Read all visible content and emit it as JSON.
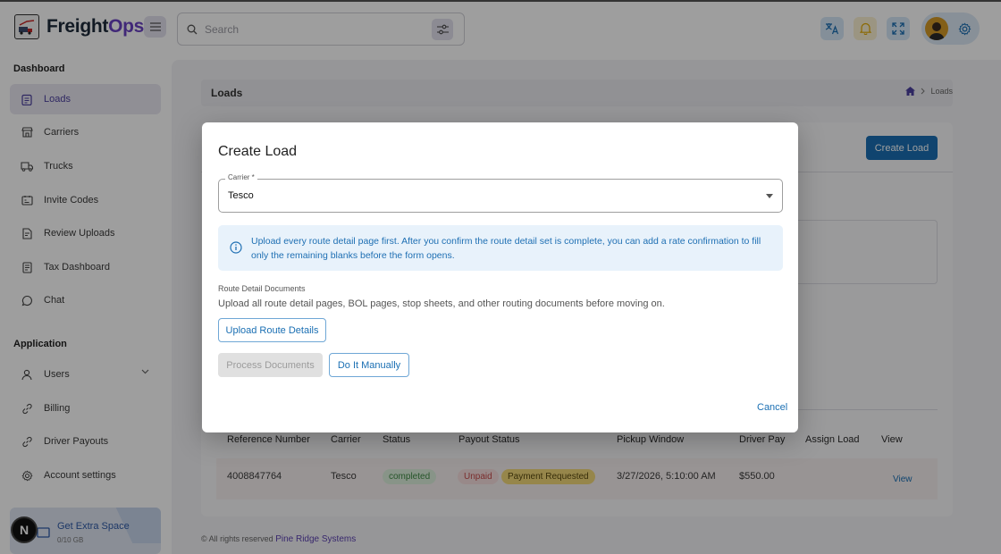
{
  "app": {
    "name_part1": "Freight",
    "name_part2": "Ops"
  },
  "header": {
    "search_placeholder": "Search",
    "colors": {
      "accent_blue": "#1a6fb3",
      "brand_purple": "#6a42c2"
    }
  },
  "sidebar": {
    "sections": [
      {
        "title": "Dashboard"
      },
      {
        "title": "Application"
      }
    ],
    "dashboard_items": [
      {
        "label": "Loads",
        "icon": "clipboard-icon",
        "active": true
      },
      {
        "label": "Carriers",
        "icon": "store-icon"
      },
      {
        "label": "Trucks",
        "icon": "truck-icon"
      },
      {
        "label": "Invite Codes",
        "icon": "ticket-icon"
      },
      {
        "label": "Review Uploads",
        "icon": "document-check-icon"
      },
      {
        "label": "Tax Dashboard",
        "icon": "receipt-icon"
      },
      {
        "label": "Chat",
        "icon": "chat-icon"
      }
    ],
    "application_items": [
      {
        "label": "Users",
        "icon": "user-icon"
      },
      {
        "label": "Billing",
        "icon": "link-icon"
      },
      {
        "label": "Driver Payouts",
        "icon": "link-icon"
      },
      {
        "label": "Account settings",
        "icon": "gear-icon"
      }
    ],
    "promo": {
      "title": "Get Extra Space",
      "subtitle": "0/10 GB"
    },
    "fab_letter": "N"
  },
  "page": {
    "title": "Loads",
    "breadcrumb": "Loads",
    "create_button": "Create Load",
    "table": {
      "headers": [
        "Reference Number",
        "Carrier",
        "Status",
        "Payout Status",
        "Pickup Window",
        "Driver Pay",
        "Assign Load",
        "View"
      ],
      "rows": [
        {
          "reference": "4008847764",
          "carrier": "Tesco",
          "status": "completed",
          "payout_status": "Unpaid",
          "payout_request": "Payment Requested",
          "pickup_window": "3/27/2026, 5:10:00 AM",
          "driver_pay": "$550.00",
          "view": "View"
        }
      ]
    },
    "footer": {
      "text": "© All rights reserved",
      "link": "Pine Ridge Systems"
    }
  },
  "modal": {
    "title": "Create Load",
    "carrier_label": "Carrier *",
    "carrier_value": "Tesco",
    "info": "Upload every route detail page first. After you confirm the route detail set is complete, you can add a rate confirmation to fill only the remaining blanks before the form opens.",
    "section_label": "Route Detail Documents",
    "section_desc": "Upload all route detail pages, BOL pages, stop sheets, and other routing documents before moving on.",
    "upload_button": "Upload Route Details",
    "process_button": "Process Documents",
    "manual_button": "Do It Manually",
    "cancel_button": "Cancel"
  }
}
